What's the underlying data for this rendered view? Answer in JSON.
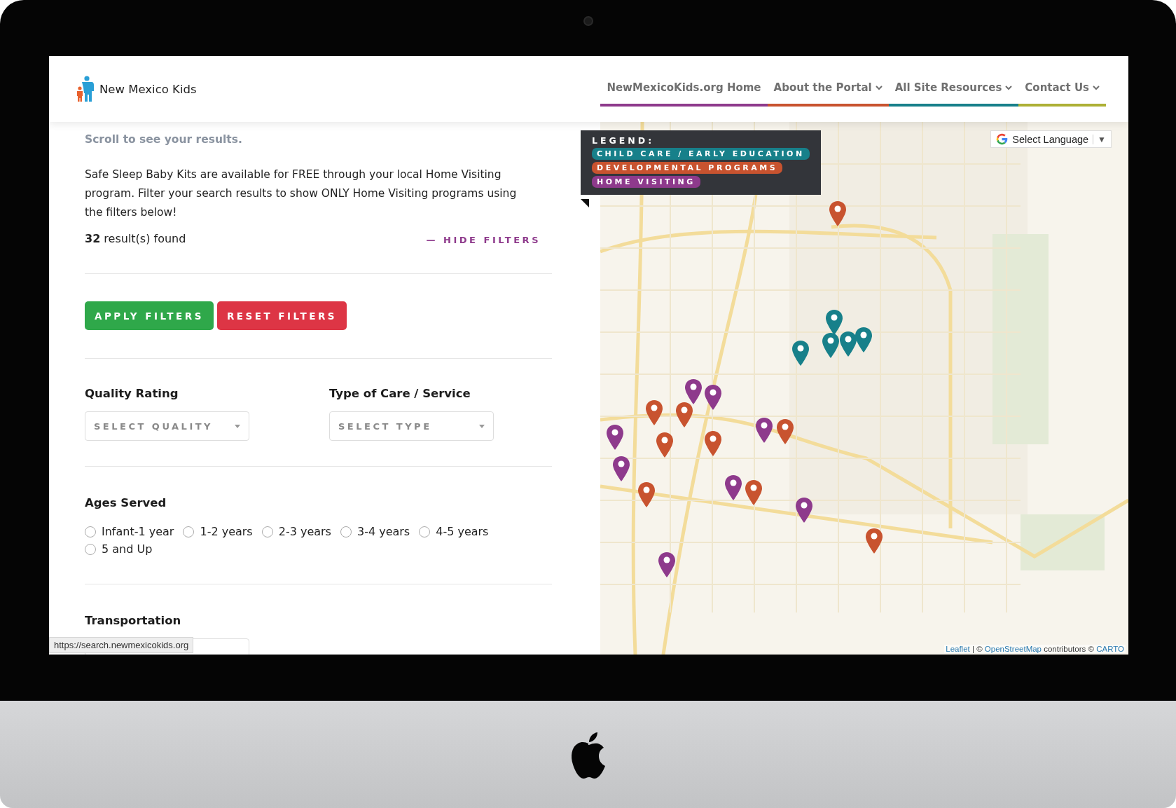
{
  "site": {
    "name": "New Mexico Kids"
  },
  "nav": [
    {
      "label": "NewMexicoKids.org Home",
      "dropdown": false,
      "color": "#8e3a8c"
    },
    {
      "label": "About the Portal",
      "dropdown": true,
      "color": "#c8532f"
    },
    {
      "label": "All Site Resources",
      "dropdown": true,
      "color": "#17808a"
    },
    {
      "label": "Contact Us",
      "dropdown": true,
      "color": "#adb035"
    }
  ],
  "panel": {
    "scroll_hint": "Scroll to see your results.",
    "intro": "Safe Sleep Baby Kits are available for FREE through your local Home Visiting program. Filter your search results to show ONLY Home Visiting programs using the filters below!",
    "result_count": "**32** result(s) found",
    "hide_filters": {
      "icon": "—",
      "label": "HIDE FILTERS"
    },
    "buttons": [
      {
        "label": "APPLY FILTERS",
        "kind": "apply"
      },
      {
        "label": "RESET FILTERS",
        "kind": "reset"
      }
    ],
    "selects": [
      {
        "label": "Quality Rating",
        "placeholder": "SELECT QUALITY"
      },
      {
        "label": "Type of Care / Service",
        "placeholder": "SELECT TYPE"
      }
    ],
    "ages": {
      "label": "Ages Served",
      "options": [
        {
          "label": "Infant-1 year",
          "checked": false
        },
        {
          "label": "1-2 years",
          "checked": false
        },
        {
          "label": "2-3 years",
          "checked": false
        },
        {
          "label": "3-4 years",
          "checked": false
        },
        {
          "label": "4-5 years",
          "checked": false
        },
        {
          "label": "5 and Up",
          "checked": false
        }
      ]
    },
    "transportation": {
      "label": "Transportation"
    }
  },
  "map": {
    "legend": {
      "title": "LEGEND:",
      "items": [
        {
          "label": "CHILD CARE / EARLY EDUCATION",
          "color": "#17808a"
        },
        {
          "label": "DEVELOPMENTAL PROGRAMS",
          "color": "#c8532f"
        },
        {
          "label": "HOME VISITING",
          "color": "#8e3a8c"
        }
      ]
    },
    "language": {
      "label": "Select Language",
      "caret": "▼"
    },
    "pins": [
      {
        "color": "#c8532f"
      },
      {
        "color": "#c8532f"
      },
      {
        "color": "#c8532f"
      },
      {
        "color": "#c8532f"
      },
      {
        "color": "#c8532f"
      },
      {
        "color": "#c8532f"
      },
      {
        "color": "#c8532f"
      },
      {
        "color": "#c8532f"
      },
      {
        "color": "#c8532f"
      },
      {
        "color": "#17808a"
      },
      {
        "color": "#17808a"
      },
      {
        "color": "#17808a"
      },
      {
        "color": "#17808a"
      },
      {
        "color": "#17808a"
      },
      {
        "color": "#8e3a8c"
      },
      {
        "color": "#8e3a8c"
      },
      {
        "color": "#8e3a8c"
      },
      {
        "color": "#8e3a8c"
      },
      {
        "color": "#8e3a8c"
      },
      {
        "color": "#8e3a8c"
      },
      {
        "color": "#8e3a8c"
      },
      {
        "color": "#8e3a8c"
      }
    ],
    "attribution": [
      {
        "text": "Leaflet",
        "kind": "link"
      },
      {
        "text": " | © ",
        "kind": "text"
      },
      {
        "text": "OpenStreetMap",
        "kind": "link"
      },
      {
        "text": " contributors © ",
        "kind": "text"
      },
      {
        "text": "CARTO",
        "kind": "link"
      }
    ]
  },
  "status_url": "https://search.newmexicokids.org"
}
